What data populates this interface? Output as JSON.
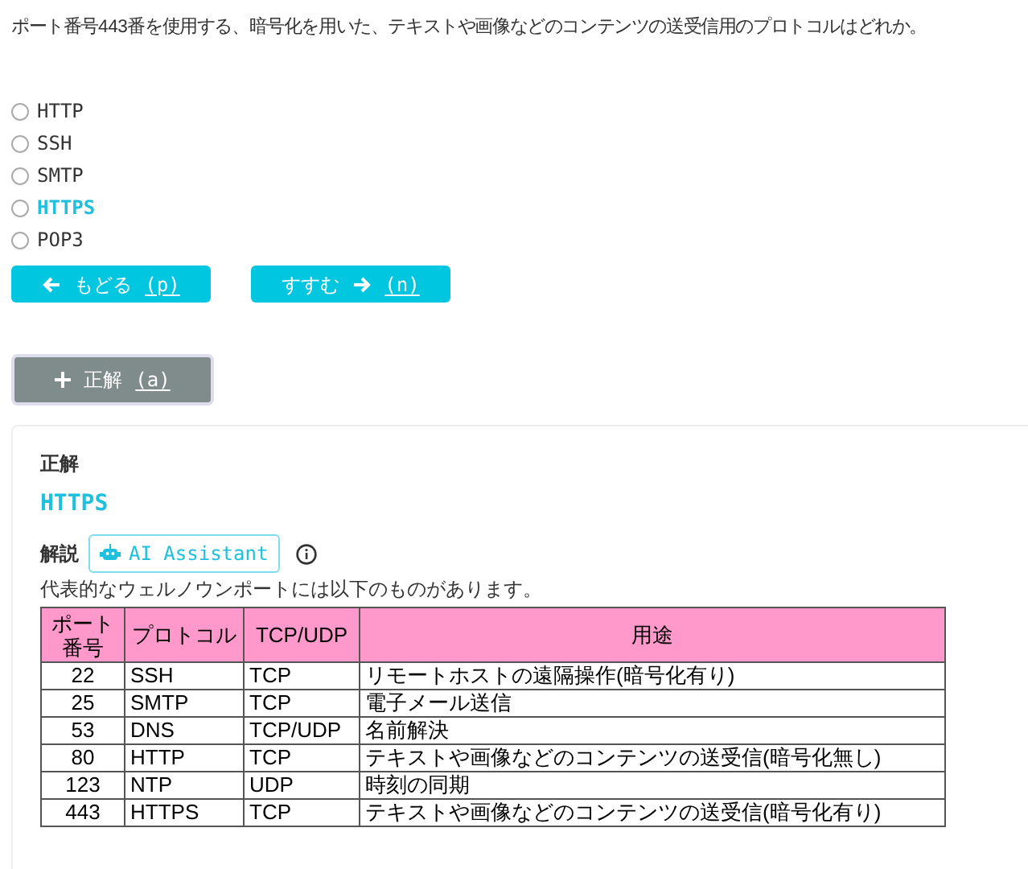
{
  "question": "ポート番号443番を使用する、暗号化を用いた、テキストや画像などのコンテンツの送受信用のプロトコルはどれか。",
  "options": [
    {
      "label": "HTTP",
      "selected": false,
      "highlighted": false
    },
    {
      "label": "SSH",
      "selected": false,
      "highlighted": false
    },
    {
      "label": "SMTP",
      "selected": false,
      "highlighted": false
    },
    {
      "label": "HTTPS",
      "selected": false,
      "highlighted": true
    },
    {
      "label": "POP3",
      "selected": false,
      "highlighted": false
    }
  ],
  "nav_buttons": [
    {
      "kind": "back",
      "label": "もどる",
      "key": "(p)"
    },
    {
      "kind": "next",
      "label": "すすむ",
      "key": "(n)"
    }
  ],
  "answer_button": {
    "label": "正解",
    "key": "(a)"
  },
  "answer": {
    "heading": "正解",
    "value": "HTTPS",
    "explanation_label": "解説",
    "assistant_button": "AI Assistant",
    "intro": "代表的なウェルノウンポートには以下のものがあります。"
  },
  "table": {
    "columns": [
      "ポート番号",
      "プロトコル",
      "TCP/UDP",
      "用途"
    ],
    "rows": [
      [
        "22",
        "SSH",
        "TCP",
        "リモートホストの遠隔操作(暗号化有り)"
      ],
      [
        "25",
        "SMTP",
        "TCP",
        "電子メール送信"
      ],
      [
        "53",
        "DNS",
        "TCP/UDP",
        "名前解決"
      ],
      [
        "80",
        "HTTP",
        "TCP",
        "テキストや画像などのコンテンツの送受信(暗号化無し)"
      ],
      [
        "123",
        "NTP",
        "UDP",
        "時刻の同期"
      ],
      [
        "443",
        "HTTPS",
        "TCP",
        "テキストや画像などのコンテンツの送受信(暗号化有り)"
      ]
    ]
  }
}
